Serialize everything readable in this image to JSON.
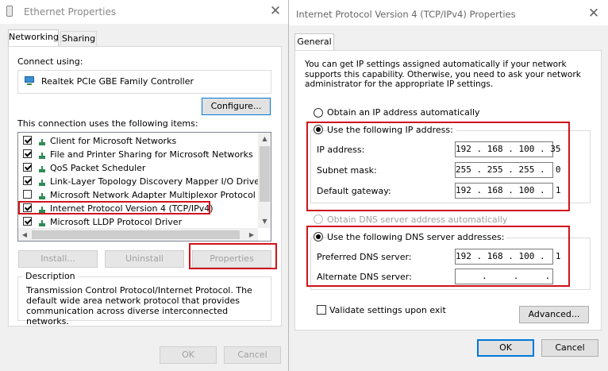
{
  "eth": {
    "title": "Ethernet Properties",
    "tabs": [
      "Networking",
      "Sharing"
    ],
    "connect_using_label": "Connect using:",
    "adapter_name": "Realtek PCIe GBE Family Controller",
    "configure_label": "Configure...",
    "items_label": "This connection uses the following items:",
    "items": [
      {
        "label": "Client for Microsoft Networks",
        "checked": true
      },
      {
        "label": "File and Printer Sharing for Microsoft Networks",
        "checked": true
      },
      {
        "label": "QoS Packet Scheduler",
        "checked": true
      },
      {
        "label": "Link-Layer Topology Discovery Mapper I/O Driver",
        "checked": true
      },
      {
        "label": "Microsoft Network Adapter Multiplexor Protocol",
        "checked": false
      },
      {
        "label": "Internet Protocol Version 4 (TCP/IPv4)",
        "checked": true
      },
      {
        "label": "Microsoft LLDP Protocol Driver",
        "checked": true
      }
    ],
    "install_label": "Install...",
    "uninstall_label": "Uninstall",
    "properties_label": "Properties",
    "description_label": "Description",
    "description_text": "Transmission Control Protocol/Internet Protocol. The default wide area network protocol that provides communication across diverse interconnected networks.",
    "ok_label": "OK",
    "cancel_label": "Cancel"
  },
  "ipv4": {
    "title": "Internet Protocol Version 4 (TCP/IPv4) Properties",
    "tab": "General",
    "intro": "You can get IP settings assigned automatically if your network supports this capability. Otherwise, you need to ask your network administrator for the appropriate IP settings.",
    "obtain_ip_auto": "Obtain an IP address automatically",
    "use_following_ip": "Use the following IP address:",
    "ip_address_label": "IP address:",
    "ip_address": "192 . 168 . 100 . 35",
    "subnet_mask_label": "Subnet mask:",
    "subnet_mask": "255 . 255 . 255 .  0",
    "gateway_label": "Default gateway:",
    "gateway": "192 . 168 . 100 .  1",
    "obtain_dns_auto": "Obtain DNS server address automatically",
    "use_following_dns": "Use the following DNS server addresses:",
    "preferred_dns_label": "Preferred DNS server:",
    "preferred_dns": "192 . 168 . 100 .  1",
    "alternate_dns_label": "Alternate DNS server:",
    "alternate_dns": "     .     .     .    ",
    "validate_label": "Validate settings upon exit",
    "advanced_label": "Advanced...",
    "ok_label": "OK",
    "cancel_label": "Cancel"
  },
  "colors": {
    "highlight": "#d0131c",
    "focus": "#0078d7"
  }
}
